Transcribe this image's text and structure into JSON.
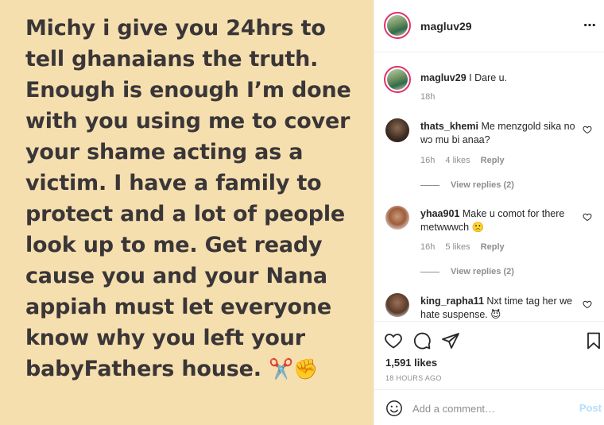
{
  "post": {
    "text": "Michy i give you 24hrs to tell ghanaians the truth. Enough is enough I’m done with you using me to cover your shame acting as a victim. I have a family to protect and a lot of people look up to me. Get ready cause you and your Nana appiah must let everyone know why you left your babyFathers house.",
    "emoji": "✂️✊",
    "background_color": "#f5dfae"
  },
  "header": {
    "username": "magluv29",
    "more_icon": "⋯"
  },
  "caption": {
    "username": "magluv29",
    "text": "I Dare u.",
    "time": "18h"
  },
  "comments": [
    {
      "username": "thats_khemi",
      "text": "Me menzgold sika no wɔ mu bi anaa?",
      "time": "16h",
      "likes": "4 likes",
      "reply": "Reply",
      "view_replies": "View replies (2)"
    },
    {
      "username": "yhaa901",
      "text": "Make u comot for there metwwwch",
      "emoji": "🙁",
      "time": "16h",
      "likes": "5 likes",
      "reply": "Reply",
      "view_replies": "View replies (2)"
    },
    {
      "username": "king_rapha11",
      "text": "Nxt time tag her we hate suspense.",
      "emoji": "😈"
    }
  ],
  "actions": {
    "likes": "1,591 likes",
    "time_ago": "18 HOURS AGO"
  },
  "add_comment": {
    "placeholder": "Add a comment…",
    "post_label": "Post"
  },
  "colors": {
    "accent_ring": "#e1306c",
    "post_button": "#b2dffc",
    "muted": "#8e8e8e"
  }
}
